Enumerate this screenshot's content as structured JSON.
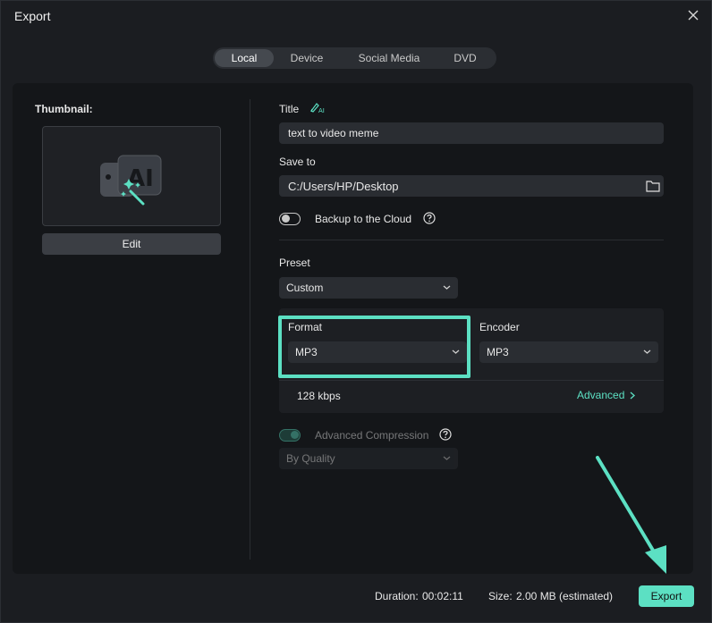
{
  "window": {
    "title": "Export"
  },
  "tabs": [
    {
      "label": "Local",
      "active": true
    },
    {
      "label": "Device",
      "active": false
    },
    {
      "label": "Social Media",
      "active": false
    },
    {
      "label": "DVD",
      "active": false
    }
  ],
  "thumbnail": {
    "label": "Thumbnail:",
    "edit_label": "Edit",
    "icon": "ai-image-icon"
  },
  "form": {
    "title_label": "Title",
    "title_value": "text to video meme",
    "save_to_label": "Save to",
    "save_to_value": "C:/Users/HP/Desktop",
    "backup_label": "Backup to the Cloud",
    "backup_on": false,
    "preset_label": "Preset",
    "preset_value": "Custom",
    "format_label": "Format",
    "format_value": "MP3",
    "encoder_label": "Encoder",
    "encoder_value": "MP3",
    "bitrate": "128 kbps",
    "advanced_label": "Advanced",
    "compression_label": "Advanced Compression",
    "compression_on": true,
    "compression_mode": "By Quality"
  },
  "footer": {
    "duration_label": "Duration:",
    "duration_value": "00:02:11",
    "size_label": "Size:",
    "size_value": "2.00 MB (estimated)",
    "export_label": "Export"
  },
  "colors": {
    "accent": "#5ce0c3",
    "background": "#1b1d21",
    "panel": "#141619"
  }
}
